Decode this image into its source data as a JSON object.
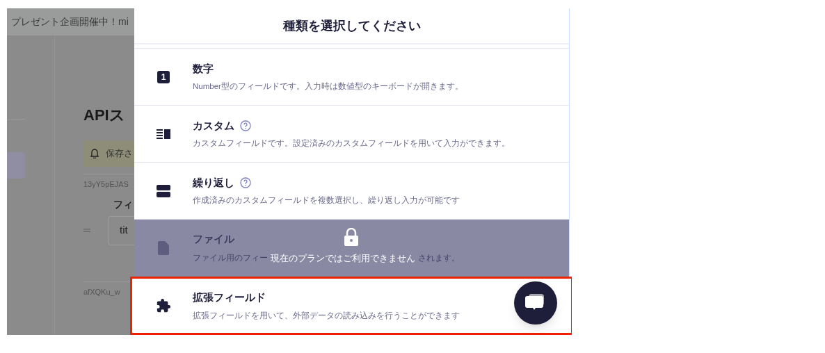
{
  "background": {
    "banner": "プレゼント企画開催中！mi",
    "heading": "APIス",
    "notice": "保存さ",
    "fields": [
      {
        "id": "13yY5pEJAS",
        "label": "フィ",
        "value": "tit"
      },
      {
        "id": "afXQKu_w"
      }
    ]
  },
  "modal": {
    "title": "種類を選択してください",
    "options": [
      {
        "kind": "number",
        "icon_text": "1",
        "title": "数字",
        "help": false,
        "description": "Number型のフィールドです。入力時は数値型のキーボードが開きます。",
        "locked": false,
        "highlighted": false
      },
      {
        "kind": "custom",
        "title": "カスタム",
        "help": true,
        "description": "カスタムフィールドです。設定済みのカスタムフィールドを用いて入力ができます。",
        "locked": false,
        "highlighted": false
      },
      {
        "kind": "repeat",
        "title": "繰り返し",
        "help": true,
        "description": "作成済みのカスタムフィールドを複数選択し、繰り返し入力が可能です",
        "locked": false,
        "highlighted": false
      },
      {
        "kind": "file",
        "title": "ファイル",
        "help": false,
        "description": "ファイル用のフィー",
        "description_tail": "されます。",
        "locked": true,
        "lock_message": "現在のプランではご利用できません",
        "highlighted": false
      },
      {
        "kind": "extension",
        "title": "拡張フィールド",
        "help": false,
        "description": "拡張フィールドを用いて、外部データの読み込みを行うことができます",
        "locked": false,
        "highlighted": true
      }
    ]
  }
}
